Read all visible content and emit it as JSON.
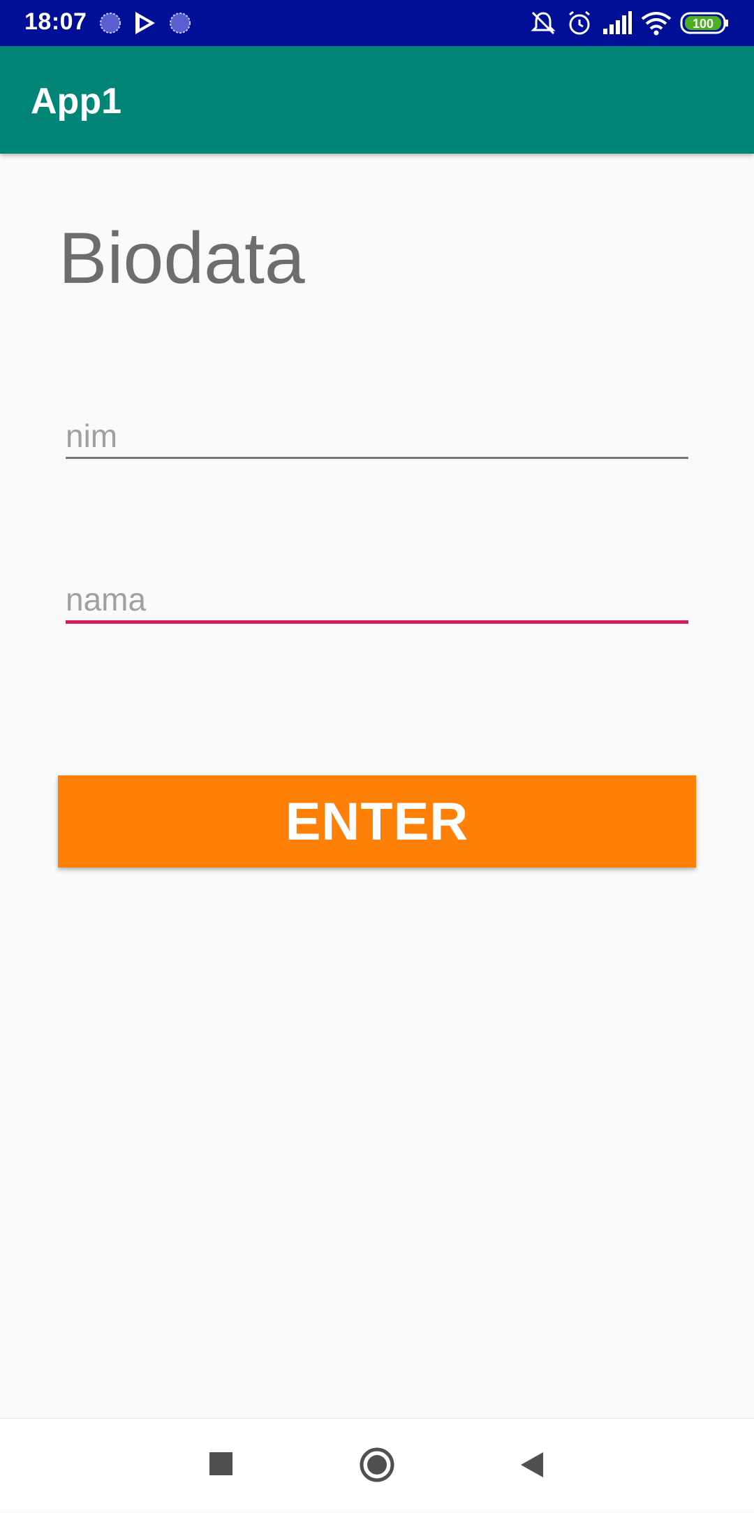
{
  "status_bar": {
    "time": "18:07",
    "battery": "100",
    "icons": [
      "sync-icon",
      "play-store-icon",
      "sync-icon",
      "notifications-off-icon",
      "alarm-icon",
      "signal-icon",
      "wifi-icon",
      "battery-icon"
    ],
    "background_color": "#000f96"
  },
  "app_bar": {
    "title": "App1",
    "background_color": "#008577"
  },
  "form": {
    "heading": "Biodata",
    "nim_placeholder": "nim",
    "nama_placeholder": "nama",
    "focused_field_color": "#d81b60",
    "button_label": "ENTER",
    "button_color": "#ff8007"
  },
  "nav_bar": {
    "icons": [
      "recents-square-icon",
      "home-circle-icon",
      "back-triangle-icon"
    ]
  }
}
